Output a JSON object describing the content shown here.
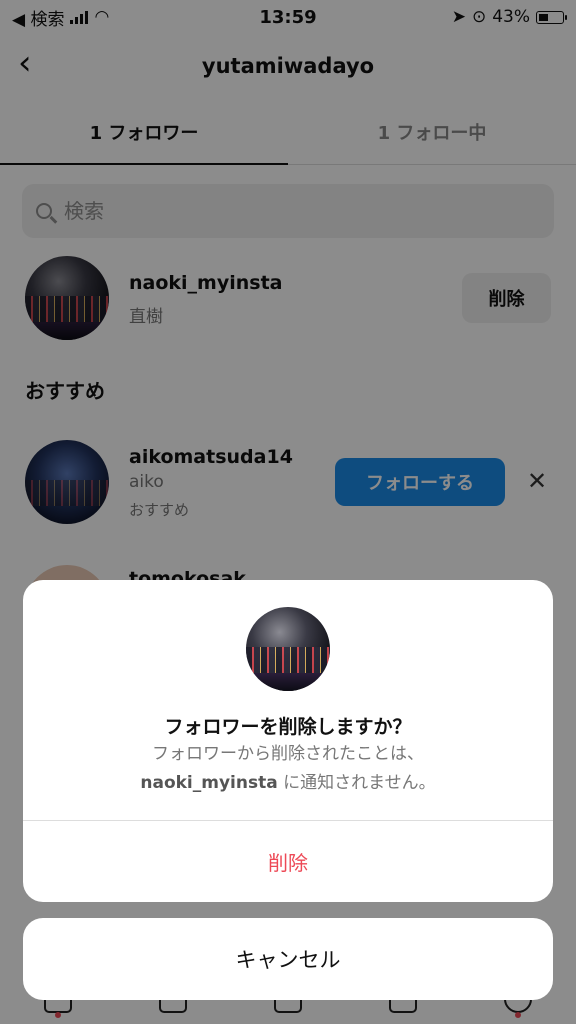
{
  "status_bar": {
    "back_app": "◀ 検索",
    "time": "13:59",
    "battery": "43%"
  },
  "header": {
    "title": "yutamiwadayo"
  },
  "tabs": [
    {
      "label": "1 フォロワー"
    },
    {
      "label": "1 フォロー中"
    }
  ],
  "search": {
    "placeholder": "検索"
  },
  "followers": [
    {
      "username": "naoki_myinsta",
      "name": "直樹",
      "action": "削除"
    }
  ],
  "suggestions": {
    "title": "おすすめ",
    "items": [
      {
        "username": "aikomatsuda14",
        "name": "aiko",
        "reason": "おすすめ",
        "action": "フォローする"
      },
      {
        "username": "tomokosak",
        "name": "",
        "reason": "",
        "action": ""
      }
    ]
  },
  "dialog": {
    "title": "フォロワーを削除しますか？",
    "line1": "フォロワーから削除されたことは、",
    "username": "naoki_myinsta",
    "line2_suffix": "に通知されません。",
    "delete_label": "削除",
    "cancel_label": "キャンセル"
  },
  "colors": {
    "accent_blue": "#1b8ae8",
    "destructive_red": "#ed4956"
  }
}
